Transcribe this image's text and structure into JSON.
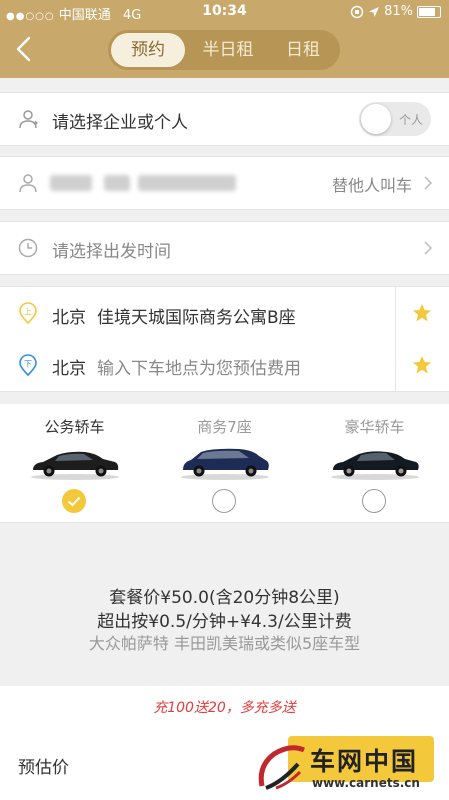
{
  "status_bar": {
    "signal_dots": "●●○○○",
    "carrier": "中国联通",
    "network": "4G",
    "time": "10:34",
    "battery": "81%",
    "battery_level": 0.81
  },
  "header": {
    "tabs": [
      {
        "label": "预约",
        "active": true
      },
      {
        "label": "半日租",
        "active": false
      },
      {
        "label": "日租",
        "active": false
      }
    ]
  },
  "account": {
    "placeholder": "请选择企业或个人",
    "toggle_label": "个人",
    "toggle_on": false
  },
  "passenger": {
    "action": "替他人叫车"
  },
  "departure_time": {
    "placeholder": "请选择出发时间"
  },
  "pickup": {
    "city": "北京",
    "address": "佳境天城国际商务公寓B座"
  },
  "dropoff": {
    "city": "北京",
    "placeholder": "输入下车地点为您预估费用"
  },
  "car_types": [
    {
      "label": "公务轿车",
      "selected": true
    },
    {
      "label": "商务7座",
      "selected": false
    },
    {
      "label": "豪华轿车",
      "selected": false
    }
  ],
  "pricing": {
    "package": "套餐价¥50.0(含20分钟8公里)",
    "overage": "超出按¥0.5/分钟+¥4.3/公里计费",
    "models": "大众帕萨特 丰田凯美瑞或类似5座车型"
  },
  "promo": "充100送20，多充多送",
  "estimate_label": "预估价",
  "watermark": {
    "brand": "车网中国",
    "url": "www.carnets.cn"
  },
  "colors": {
    "brand_gold": "#c9a96b",
    "accent_yellow": "#f4c83b",
    "promo_red": "#e53b3b",
    "dropoff_blue": "#2f8fe0"
  }
}
